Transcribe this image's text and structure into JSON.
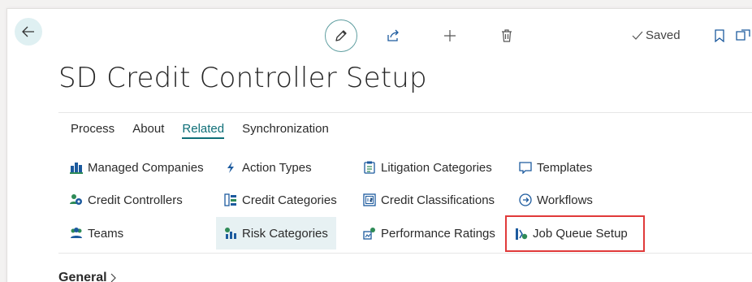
{
  "header": {
    "title": "SD Credit Controller Setup",
    "saved_label": "Saved"
  },
  "tabs": [
    {
      "label": "Process",
      "active": false
    },
    {
      "label": "About",
      "active": false
    },
    {
      "label": "Related",
      "active": true
    },
    {
      "label": "Synchronization",
      "active": false
    }
  ],
  "actions": {
    "col1": [
      "Managed Companies",
      "Credit Controllers",
      "Teams"
    ],
    "col2": [
      "Action Types",
      "Credit Categories",
      "Risk Categories"
    ],
    "col3": [
      "Litigation Categories",
      "Credit Classifications",
      "Performance Ratings"
    ],
    "col4": [
      "Templates",
      "Workflows",
      "Job Queue Setup"
    ]
  },
  "section": {
    "general_label": "General"
  },
  "colors": {
    "accent": "#0f6f78",
    "highlight_bg": "#e7f1f3",
    "annotation_border": "#e03a3a",
    "icon_blue": "#1c5a9e",
    "icon_green": "#2e8b57"
  },
  "icons": {
    "back": "arrow-left-icon",
    "edit": "pencil-icon",
    "share": "share-icon",
    "new": "plus-icon",
    "delete": "trash-icon",
    "saved": "check-icon",
    "bookmark": "bookmark-icon",
    "popout": "open-in-new-window-icon"
  }
}
